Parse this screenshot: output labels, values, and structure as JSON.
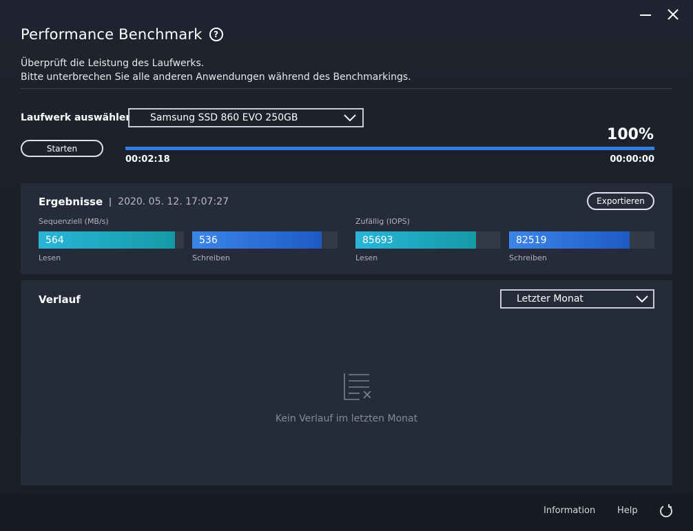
{
  "header": {
    "title": "Performance Benchmark",
    "help_glyph": "?",
    "desc_line1": "Überprüft die Leistung des Laufwerks.",
    "desc_line2": "Bitte unterbrechen Sie alle anderen Anwendungen während des Benchmarkings."
  },
  "drive": {
    "label": "Laufwerk auswählen",
    "selected": "Samsung SSD 860 EVO 250GB"
  },
  "controls": {
    "start_label": "Starten",
    "percent": "100%",
    "progress": 1.0,
    "elapsed": "00:02:18",
    "remaining": "00:00:00"
  },
  "results": {
    "title": "Ergebnisse",
    "timestamp": "2020. 05. 12. 17:07:27",
    "export_label": "Exportieren",
    "sequential": {
      "label": "Sequenziell (MB/s)",
      "read": {
        "value": "564",
        "fill": 0.94,
        "label": "Lesen"
      },
      "write": {
        "value": "536",
        "fill": 0.89,
        "label": "Schreiben"
      }
    },
    "random": {
      "label": "Zufällig (IOPS)",
      "read": {
        "value": "85693",
        "fill": 0.83,
        "label": "Lesen"
      },
      "write": {
        "value": "82519",
        "fill": 0.83,
        "label": "Schreiben"
      }
    }
  },
  "history": {
    "title": "Verlauf",
    "range_selected": "Letzter Monat",
    "empty_text": "Kein Verlauf im letzten Monat"
  },
  "footer": {
    "information": "Information",
    "help": "Help"
  },
  "colors": {
    "accent_blue": "#2f7ee0",
    "bar_cyan": "#2ab5d8",
    "bar_blue": "#3c86e8",
    "panel": "#252b38"
  },
  "icons": [
    "minimize-icon",
    "close-icon",
    "help-icon",
    "chevron-down-icon",
    "empty-list-icon",
    "refresh-icon"
  ]
}
